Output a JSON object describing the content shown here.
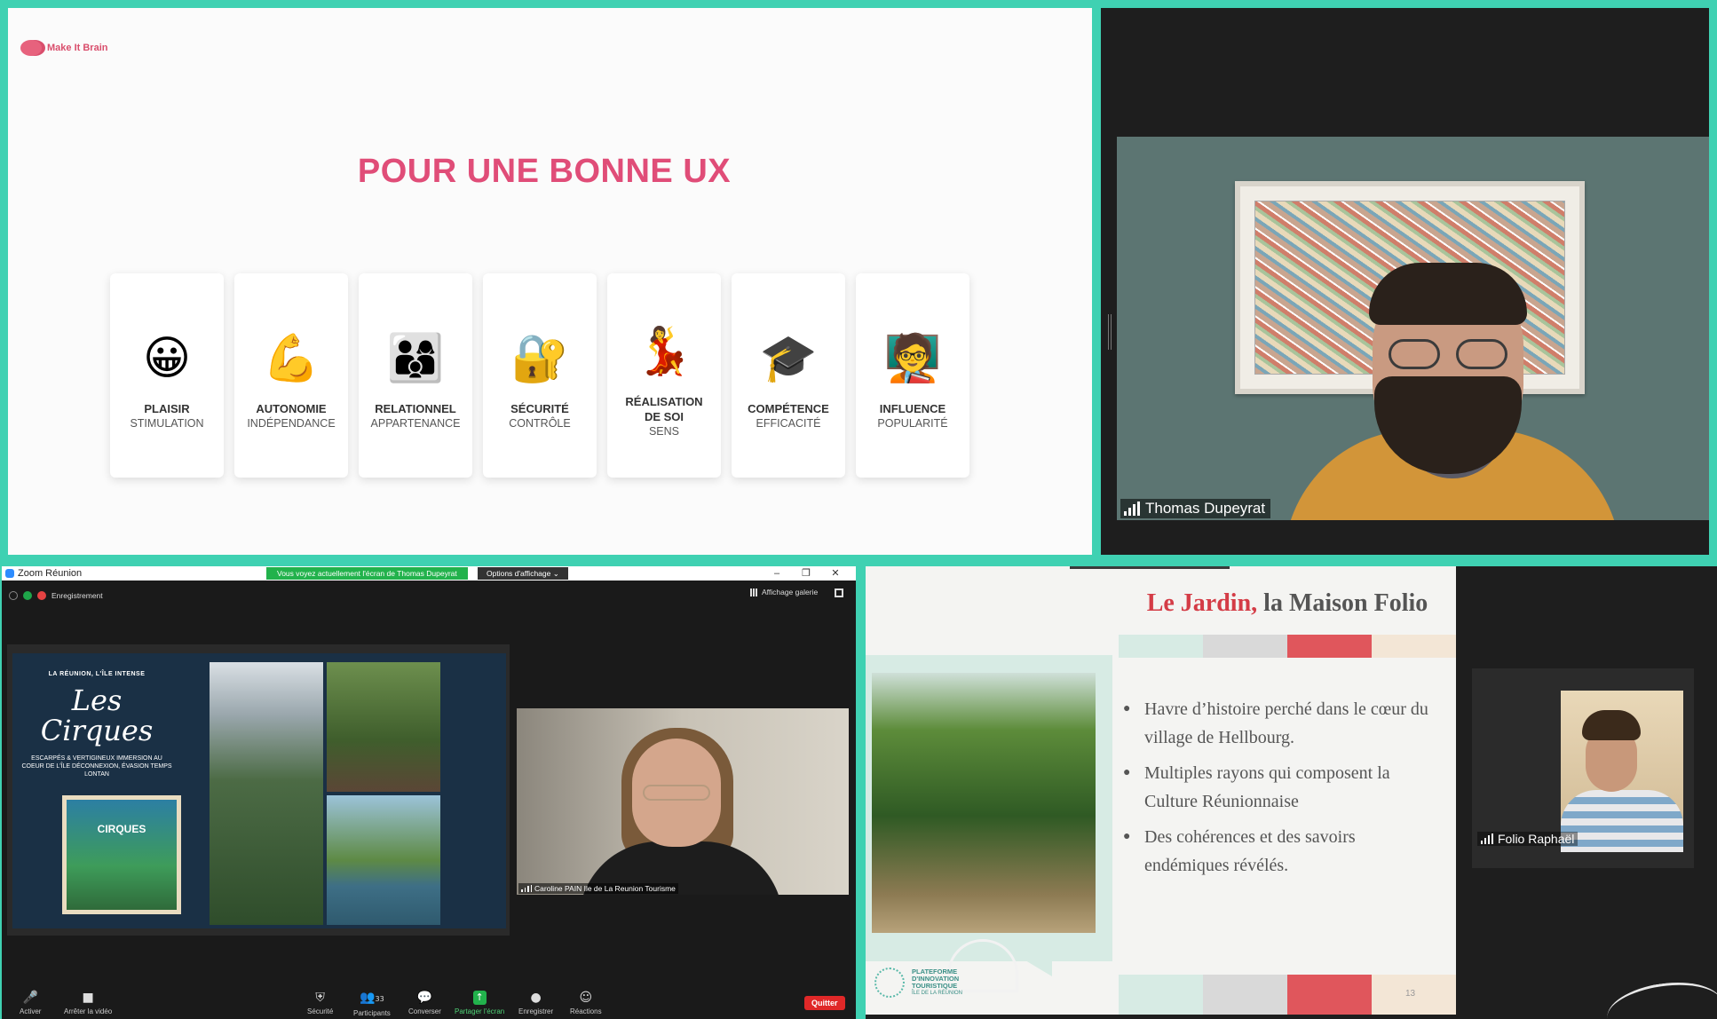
{
  "top_left": {
    "brand": "Make It Brain",
    "title": "POUR UNE BONNE UX",
    "cards": [
      {
        "emoji": "😀",
        "title": "PLAISIR",
        "subtitle": "STIMULATION"
      },
      {
        "emoji": "💪",
        "title": "AUTONOMIE",
        "subtitle": "INDÉPENDANCE"
      },
      {
        "emoji": "👨‍👩‍👦",
        "title": "RELATIONNEL",
        "subtitle": "APPARTENANCE"
      },
      {
        "emoji": "🔐",
        "title": "SÉCURITÉ",
        "subtitle": "CONTRÔLE"
      },
      {
        "emoji": "💃",
        "title": "RÉALISATION DE SOI",
        "subtitle": "SENS"
      },
      {
        "emoji": "🎓",
        "title": "COMPÉTENCE",
        "subtitle": "EFFICACITÉ"
      },
      {
        "emoji": "🧑‍🏫",
        "title": "INFLUENCE",
        "subtitle": "POPULARITÉ"
      }
    ]
  },
  "top_right": {
    "participant_name": "Thomas Dupeyrat"
  },
  "zoom_window": {
    "title": "Zoom Réunion",
    "share_banner": "Vous voyez actuellement l'écran de Thomas Dupeyrat",
    "view_options": "Options d'affichage",
    "recording_label": "Enregistrement",
    "gallery_view": "Affichage galerie",
    "shared_poster": {
      "tagline": "LA RÉUNION, L'ÎLE INTENSE",
      "title_line1": "Les",
      "title_line2": "Cirques",
      "description": "ESCARPÉS & VERTIGINEUX IMMERSION AU COEUR DE L'ÎLE DÉCONNEXION, ÉVASION TEMPS LONTAN",
      "book_title": "CIRQUES"
    },
    "participant_label": "Caroline PAIN Ile de La Reunion Tourisme",
    "toolbar": {
      "mute": "Activer",
      "video": "Arrêter la vidéo",
      "security": "Sécurité",
      "participants": "Participants",
      "participants_count": "33",
      "chat": "Converser",
      "share": "Partager l'écran",
      "record": "Enregistrer",
      "reactions": "Réactions",
      "quit": "Quitter"
    }
  },
  "bottom_right": {
    "slide_title_highlight": "Le Jardin,",
    "slide_title_rest": " la Maison Folio",
    "bullets": [
      "Havre d’histoire perché dans le cœur du village de Hellbourg.",
      "Multiples rayons qui composent la Culture Réunionnaise",
      "Des cohérences et des savoirs endémiques révélés."
    ],
    "footer_logo_line1": "PLATEFORME",
    "footer_logo_line2": "D'INNOVATION",
    "footer_logo_line3": "TOURISTIQUE",
    "footer_logo_line4": "ÎLE DE LA RÉUNION",
    "page_number": "13",
    "participant_name": "Folio Raphaël",
    "band_colors": [
      "#d7ebe4",
      "#d9d9d9",
      "#e0565c",
      "#f3e6d6"
    ]
  }
}
